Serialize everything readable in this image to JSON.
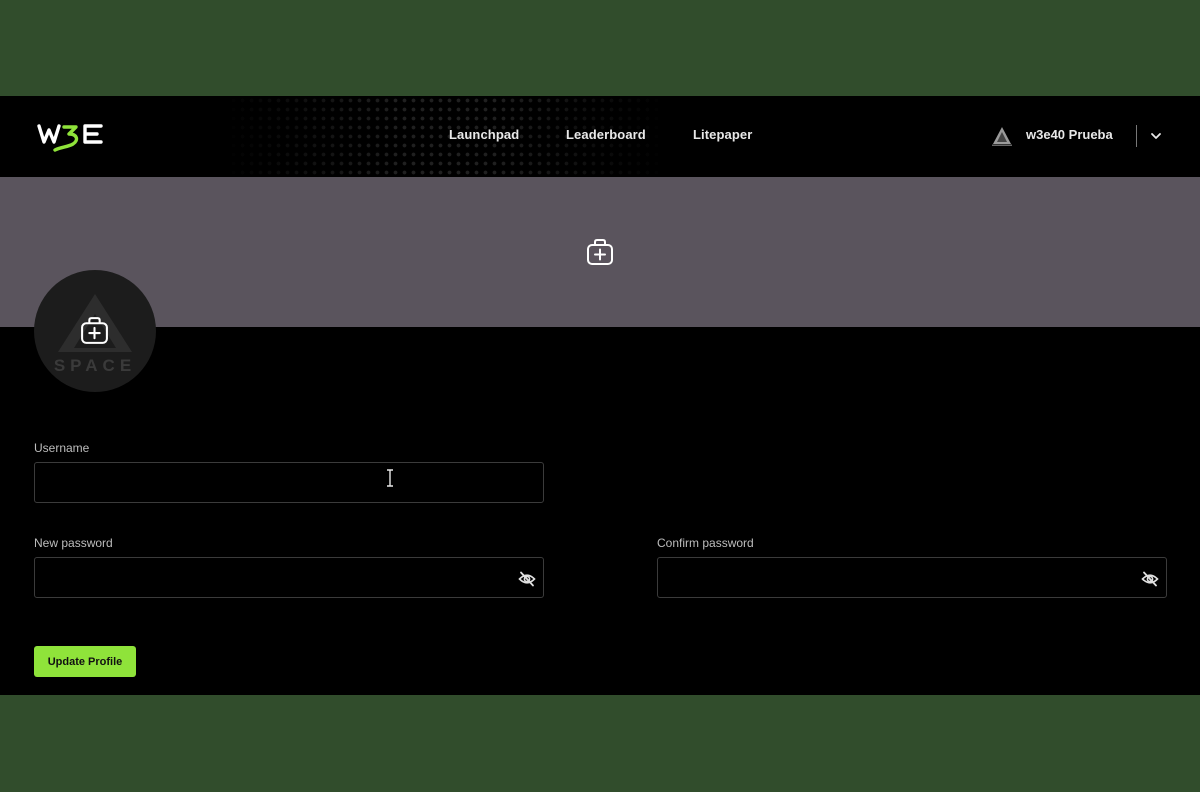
{
  "header": {
    "logo_text": "w3e",
    "nav": [
      "Launchpad",
      "Leaderboard",
      "Litepaper"
    ],
    "user_name": "w3e40 Prueba"
  },
  "avatar": {
    "placeholder_text": "SPACE"
  },
  "form": {
    "username_label": "Username",
    "username_value": "",
    "new_password_label": "New password",
    "new_password_value": "",
    "confirm_password_label": "Confirm password",
    "confirm_password_value": "",
    "submit_label": "Update Profile"
  },
  "colors": {
    "page_bg": "#314d2c",
    "app_bg": "#000000",
    "cover_bg": "#5a545d",
    "accent": "#8fe33a"
  },
  "icons": {
    "cover_upload": "image-plus-icon",
    "avatar_upload": "image-plus-icon",
    "password_toggle": "eye-off-icon",
    "user_menu": "chevron-down-icon"
  }
}
